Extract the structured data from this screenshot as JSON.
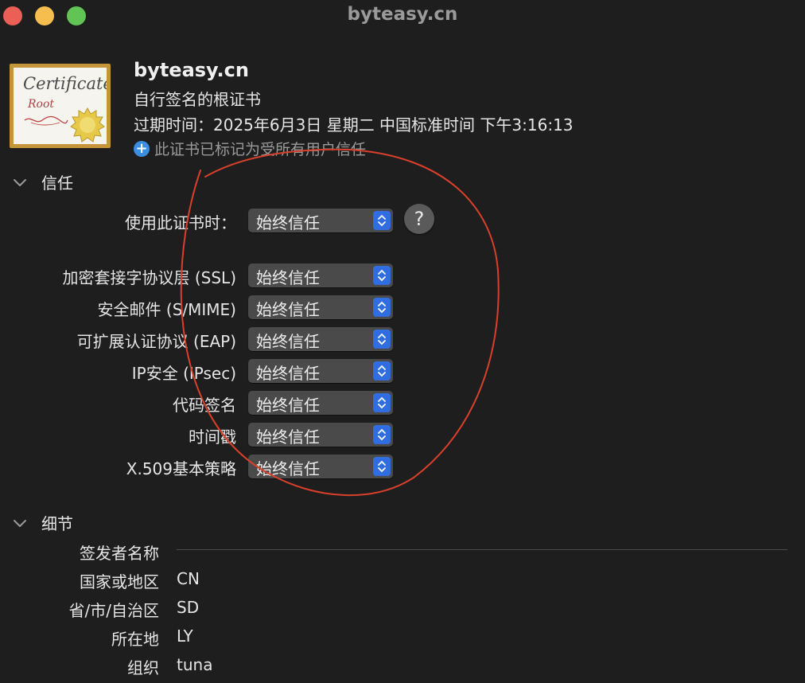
{
  "window": {
    "title": "byteasy.cn"
  },
  "certificate": {
    "icon_text_top": "Certificate",
    "icon_text_bottom": "Root",
    "name": "byteasy.cn",
    "kind": "自行签名的根证书",
    "expiry": "过期时间：2025年6月3日 星期二 中国标准时间 下午3:16:13",
    "trust_note": "此证书已标记为受所有用户信任"
  },
  "trust": {
    "heading": "信任",
    "use_cert_label": "使用此证书时：",
    "use_cert_value": "始终信任",
    "help_label": "?",
    "rows": [
      {
        "label": "加密套接字协议层 (SSL)",
        "value": "始终信任"
      },
      {
        "label": "安全邮件 (S/MIME)",
        "value": "始终信任"
      },
      {
        "label": "可扩展认证协议 (EAP)",
        "value": "始终信任"
      },
      {
        "label": "IP安全 (IPsec)",
        "value": "始终信任"
      },
      {
        "label": "代码签名",
        "value": "始终信任"
      },
      {
        "label": "时间戳",
        "value": "始终信任"
      },
      {
        "label": "X.509基本策略",
        "value": "始终信任"
      }
    ]
  },
  "details": {
    "heading": "细节",
    "issuer_heading": "签发者名称",
    "rows": [
      {
        "label": "国家或地区",
        "value": "CN"
      },
      {
        "label": "省/市/自治区",
        "value": "SD"
      },
      {
        "label": "所在地",
        "value": "LY"
      },
      {
        "label": "组织",
        "value": "tuna"
      }
    ]
  },
  "colors": {
    "background": "#1e1e1e",
    "popup": "#4a4a4a",
    "stepper": "#2f6de0",
    "annotation": "#d9402c"
  }
}
